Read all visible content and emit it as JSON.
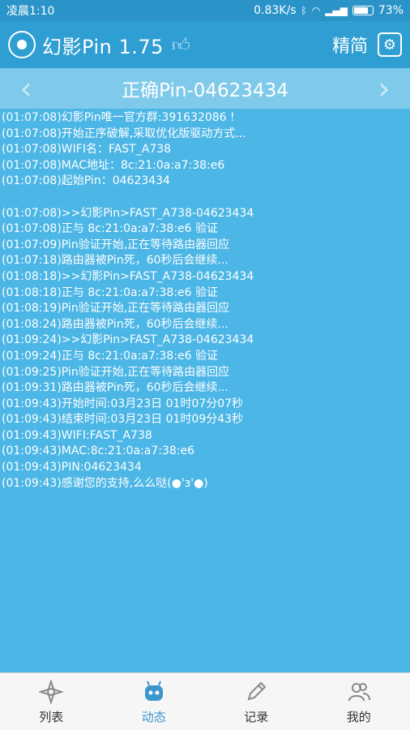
{
  "statusbar": {
    "time": "凌晨1:10",
    "speed": "0.83K/s",
    "battery": "73%",
    "icons": [
      "clock-icon",
      "bluetooth-icon",
      "wifi-icon",
      "signal-icon",
      "battery-icon"
    ]
  },
  "header": {
    "title": "幻影Pin 1.75",
    "lang_label": "精简",
    "icons": [
      "logo-icon",
      "thumbs-up-icon",
      "settings-icon"
    ]
  },
  "pinbar": {
    "title": "正确Pin-04623434"
  },
  "log": [
    "(01:07:08)幻影Pin唯一官方群:391632086 !",
    "(01:07:08)开始正序破解,采取优化版驱动方式...",
    "(01:07:08)WIFI名：FAST_A738",
    "(01:07:08)MAC地址：8c:21:0a:a7:38:e6",
    "(01:07:08)起始Pin：04623434",
    "",
    "(01:07:08)>>幻影Pin>FAST_A738-04623434",
    "(01:07:08)正与 8c:21:0a:a7:38:e6 验证",
    "(01:07:09)Pin验证开始,正在等待路由器回应",
    "(01:07:18)路由器被Pin死，60秒后会继续...",
    "(01:08:18)>>幻影Pin>FAST_A738-04623434",
    "(01:08:18)正与 8c:21:0a:a7:38:e6 验证",
    "(01:08:19)Pin验证开始,正在等待路由器回应",
    "(01:08:24)路由器被Pin死，60秒后会继续...",
    "(01:09:24)>>幻影Pin>FAST_A738-04623434",
    "(01:09:24)正与 8c:21:0a:a7:38:e6 验证",
    "(01:09:25)Pin验证开始,正在等待路由器回应",
    "(01:09:31)路由器被Pin死，60秒后会继续...",
    "(01:09:43)开始时间:03月23日 01时07分07秒",
    "(01:09:43)结束时间:03月23日 01时09分43秒",
    "(01:09:43)WIFI:FAST_A738",
    "(01:09:43)MAC:8c:21:0a:a7:38:e6",
    "(01:09:43)PIN:04623434",
    "(01:09:43)感谢您的支持,么么哒(●'з'●)"
  ],
  "nav": [
    {
      "label": "列表",
      "icon": "compass-icon",
      "active": false
    },
    {
      "label": "动态",
      "icon": "robot-icon",
      "active": true
    },
    {
      "label": "记录",
      "icon": "pencil-icon",
      "active": false
    },
    {
      "label": "我的",
      "icon": "users-icon",
      "active": false
    }
  ],
  "colors": {
    "background": "#4cb6e6",
    "appbar": "#2f9ed2",
    "pinbar": "#7fcaea",
    "nav_active": "#3a96cc"
  }
}
